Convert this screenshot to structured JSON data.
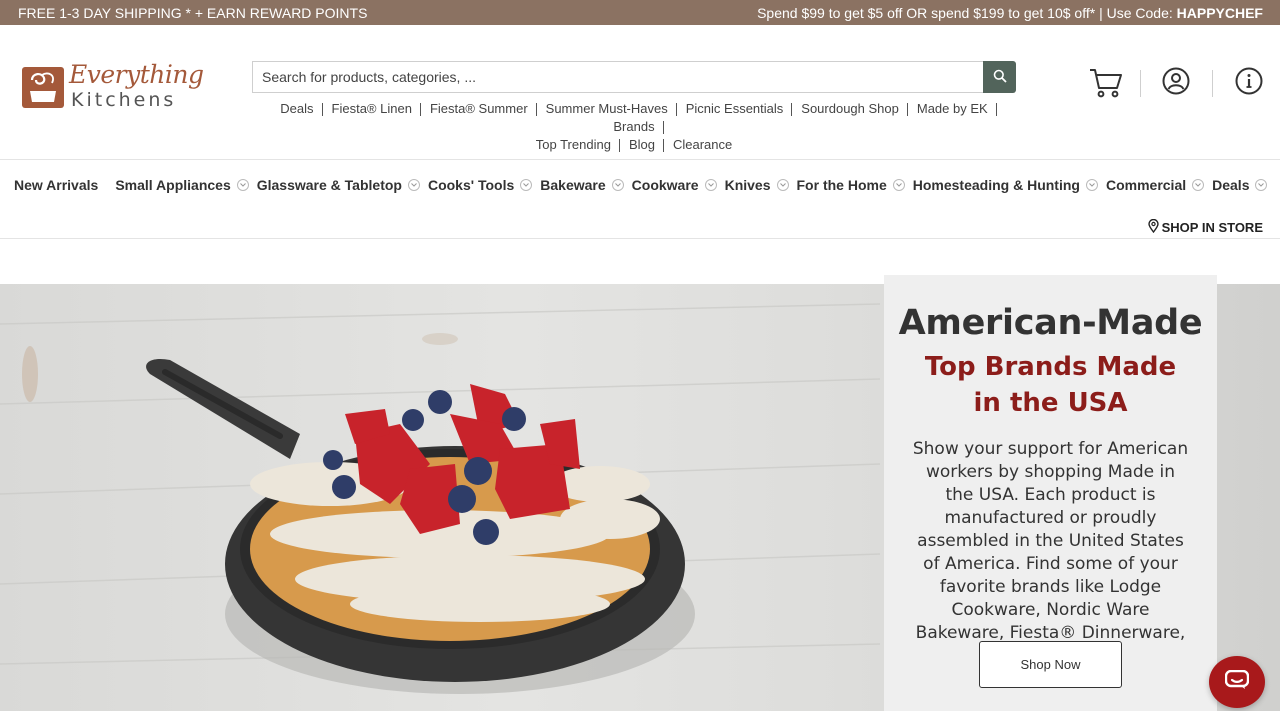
{
  "promo": {
    "left_text": "FREE 1-3 DAY SHIPPING * + EARN REWARD POINTS",
    "right_text": "Spend $99 to get $5 off OR spend $199 to get 10$ off* | Use Code: ",
    "code": "HAPPYCHEF",
    "bg_color": "#8b7262"
  },
  "logo": {
    "line1": "Everything",
    "line2": "Kitchens",
    "brand_color": "#a4593a"
  },
  "search": {
    "placeholder": "Search for products, categories, ...",
    "value": "",
    "icon": "search-icon"
  },
  "quick_links": [
    "Deals",
    "Fiesta® Linen",
    "Fiesta® Summer",
    "Summer Must-Haves",
    "Picnic Essentials",
    "Sourdough Shop",
    "Made by EK",
    "Brands",
    "Top Trending",
    "Blog",
    "Clearance"
  ],
  "header_icons": [
    "cart-icon",
    "user-icon",
    "info-icon"
  ],
  "categories": [
    {
      "label": "New Arrivals",
      "has_dropdown": false
    },
    {
      "label": "Small Appliances",
      "has_dropdown": true
    },
    {
      "label": "Glassware & Tabletop",
      "has_dropdown": true
    },
    {
      "label": "Cooks' Tools",
      "has_dropdown": true
    },
    {
      "label": "Bakeware",
      "has_dropdown": true
    },
    {
      "label": "Cookware",
      "has_dropdown": true
    },
    {
      "label": "Knives",
      "has_dropdown": true
    },
    {
      "label": "For the Home",
      "has_dropdown": true
    },
    {
      "label": "Homesteading & Hunting",
      "has_dropdown": true
    },
    {
      "label": "Commercial",
      "has_dropdown": true
    },
    {
      "label": "Deals",
      "has_dropdown": true
    }
  ],
  "shop_in_store": "SHOP IN STORE",
  "hero": {
    "title": "American-Made",
    "subtitle": "Top Brands Made in the USA",
    "body": "Show your support for American workers by shopping Made in the USA. Each product is manufactured or proudly assembled in the United States of America. Find some of your favorite brands like Lodge Cookware, Nordic Ware Bakeware, Fiesta® Dinnerware, and more!",
    "button_label": "Shop Now",
    "subtitle_color": "#8c1d1a"
  },
  "chat": {
    "icon": "chat-icon",
    "color": "#a8191b"
  }
}
